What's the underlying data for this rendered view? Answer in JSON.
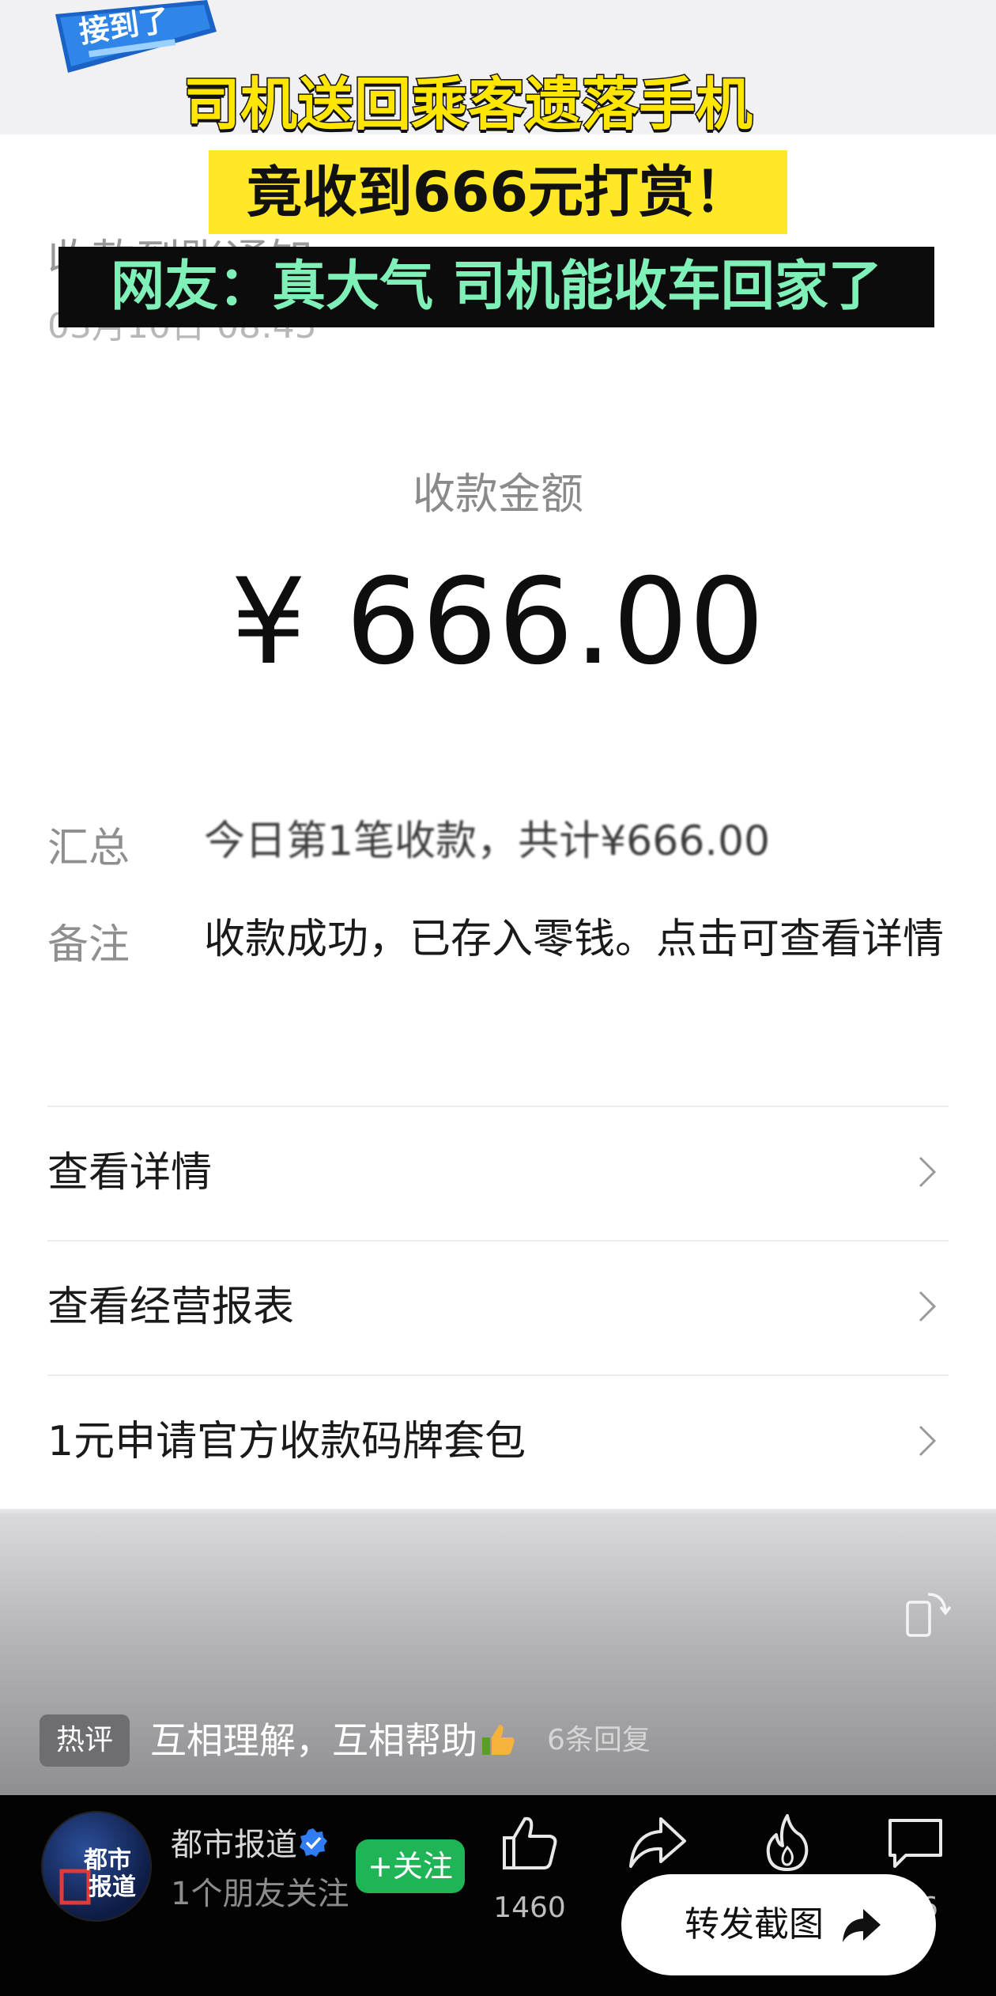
{
  "captions": {
    "line1": "司机送回乘客遗落手机",
    "line2": "竟收到666元打赏！",
    "line3": "网友：真大气 司机能收车回家了"
  },
  "notification": {
    "title": "收款到账通知",
    "time": "03月10日 08:45"
  },
  "amount": {
    "label": "收款金额",
    "value": "¥ 666.00"
  },
  "details": {
    "summary_label": "汇总",
    "summary_value": "今日第1笔收款，共计¥666.00",
    "note_label": "备注",
    "note_value": "收款成功，已存入零钱。点击可查看详情"
  },
  "menu": {
    "items": [
      {
        "label": "查看详情"
      },
      {
        "label": "查看经营报表"
      },
      {
        "label": "1元申请官方收款码牌套包"
      }
    ]
  },
  "hot_comment": {
    "badge": "热评",
    "text": "互相理解，互相帮助",
    "replies": "6条回复"
  },
  "account": {
    "name": "都市报道",
    "subtitle": "1个朋友关注",
    "follow_label": "+关注",
    "avatar_text": "都市报道"
  },
  "actions": {
    "like_count": "1460",
    "share_screenshot_label": "转发截图",
    "comment_count": "6"
  },
  "colors": {
    "caption_yellow": "#ffe600",
    "caption_green": "#7ff0b8",
    "follow_green": "#1fb455"
  }
}
